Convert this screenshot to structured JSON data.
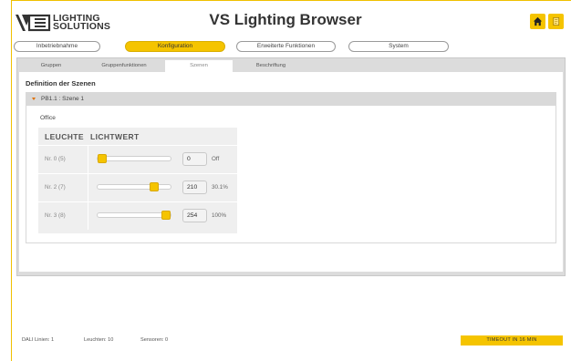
{
  "header": {
    "logo_line1": "LIGHTING",
    "logo_line2": "SOLUTIONS",
    "title": "VS Lighting Browser",
    "home_icon": "home-icon",
    "book_icon": "book-icon",
    "accent": "#f5c400"
  },
  "main_tabs": [
    {
      "label": "Inbetriebnahme",
      "active": false
    },
    {
      "label": "Konfiguration",
      "active": true
    },
    {
      "label": "Erweiterte Funktionen",
      "active": false
    },
    {
      "label": "System",
      "active": false
    }
  ],
  "sub_tabs": [
    {
      "label": "Gruppen",
      "active": false
    },
    {
      "label": "Gruppenfunktionen",
      "active": false
    },
    {
      "label": "Szenen",
      "active": true
    },
    {
      "label": "Beschriftung",
      "active": false
    }
  ],
  "content": {
    "section_title": "Definition der Szenen",
    "group_label": "PB1.1 : Szene 1",
    "room": "Office",
    "col_lamp": "LEUCHTE",
    "col_value": "LICHTWERT",
    "rows": [
      {
        "name": "Nr. 0 (5)",
        "value": "0",
        "pct": "Off",
        "level": 0
      },
      {
        "name": "Nr. 2 (7)",
        "value": "210",
        "pct": "30.1%",
        "level": 0.82
      },
      {
        "name": "Nr. 3 (8)",
        "value": "254",
        "pct": "100%",
        "level": 1.0
      }
    ]
  },
  "footer": {
    "dali": "DALI Linien: 1",
    "lamps": "Leuchten: 10",
    "sensors": "Sensoren: 0",
    "timeout": "TIMEOUT IN 16 MIN"
  }
}
